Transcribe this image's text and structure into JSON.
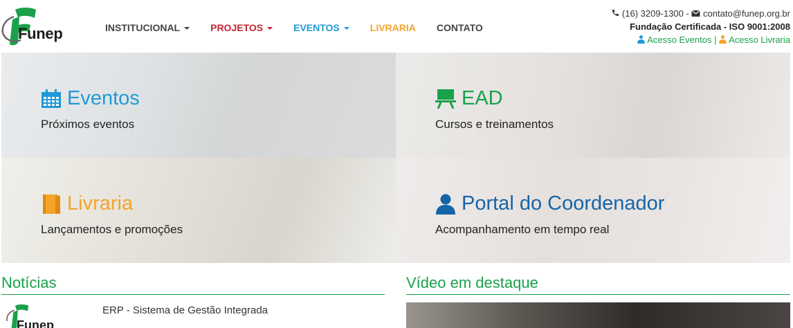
{
  "header": {
    "logo_text": "Funep",
    "nav": [
      {
        "label": "INSTITUCIONAL",
        "color": "#444444",
        "dropdown": true
      },
      {
        "label": "PROJETOS",
        "color": "#c62533",
        "dropdown": true
      },
      {
        "label": "EVENTOS",
        "color": "#1f9ad6",
        "dropdown": true
      },
      {
        "label": "LIVRARIA",
        "color": "#f2a42b",
        "dropdown": false
      },
      {
        "label": "CONTATO",
        "color": "#444444",
        "dropdown": false
      }
    ],
    "phone": "(16) 3209-1300",
    "dash": "-",
    "email": "contato@funep.org.br",
    "certification": "Fundação Certificada - ISO 9001:2008",
    "access_events": "Acesso Eventos",
    "access_separator": "|",
    "access_bookstore": "Acesso Livraria"
  },
  "tiles": [
    {
      "title": "Eventos",
      "subtitle": "Próximos eventos",
      "color": "#1f9ad6",
      "icon": "calendar-icon"
    },
    {
      "title": "EAD",
      "subtitle": "Cursos e treinamentos",
      "color": "#1aa14a",
      "icon": "presentation-icon"
    },
    {
      "title": "Livraria",
      "subtitle": "Lançamentos e promoções",
      "color": "#f2a42b",
      "icon": "book-icon"
    },
    {
      "title": "Portal do Coordenador",
      "subtitle": "Acompanhamento em tempo real",
      "color": "#1565a8",
      "icon": "user-icon"
    }
  ],
  "news": {
    "heading": "Notícias",
    "items": [
      {
        "title": "ERP - Sistema de Gestão Integrada",
        "thumb_text": "Funep"
      }
    ]
  },
  "video": {
    "heading": "Vídeo em destaque"
  },
  "colors": {
    "green": "#1aa14a",
    "logo_green": "#1aa14a"
  }
}
